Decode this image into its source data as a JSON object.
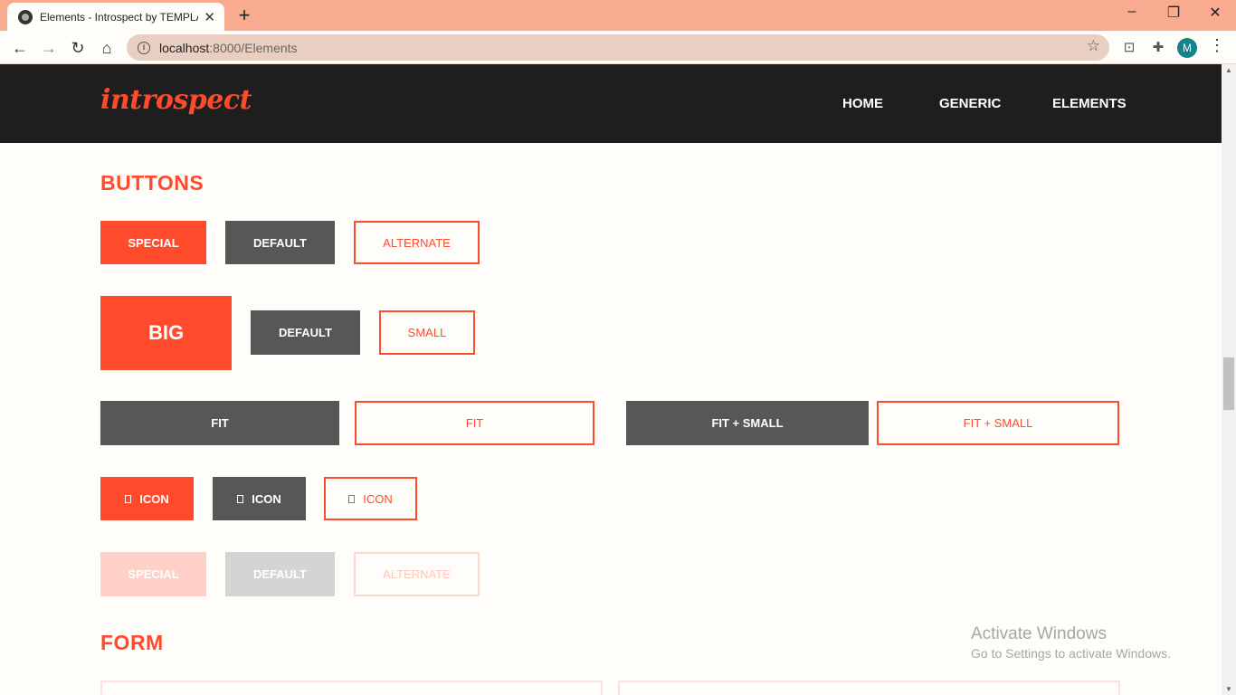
{
  "browser": {
    "tab_title": "Elements - Introspect by TEMPLATED",
    "url_host": "localhost",
    "url_path": ":8000/Elements",
    "avatar_letter": "M"
  },
  "site": {
    "logo": "introspect",
    "nav": [
      "HOME",
      "GENERIC",
      "ELEMENTS"
    ]
  },
  "sections": {
    "buttons_title": "BUTTONS",
    "form_title": "FORM"
  },
  "buttons": {
    "row1": [
      "SPECIAL",
      "DEFAULT",
      "ALTERNATE"
    ],
    "row2": [
      "BIG",
      "DEFAULT",
      "SMALL"
    ],
    "row3": [
      "FIT",
      "FIT",
      "FIT + SMALL",
      "FIT + SMALL"
    ],
    "row4": [
      "ICON",
      "ICON",
      "ICON"
    ],
    "row5_disabled": [
      "SPECIAL",
      "DEFAULT",
      "ALTERNATE"
    ]
  },
  "os_watermark": {
    "line1": "Activate Windows",
    "line2": "Go to Settings to activate Windows."
  },
  "colors": {
    "accent": "#ff4b2b",
    "header_bg": "#1e1e1e",
    "default_btn": "#575757",
    "tabbar": "#f8ab8e"
  }
}
